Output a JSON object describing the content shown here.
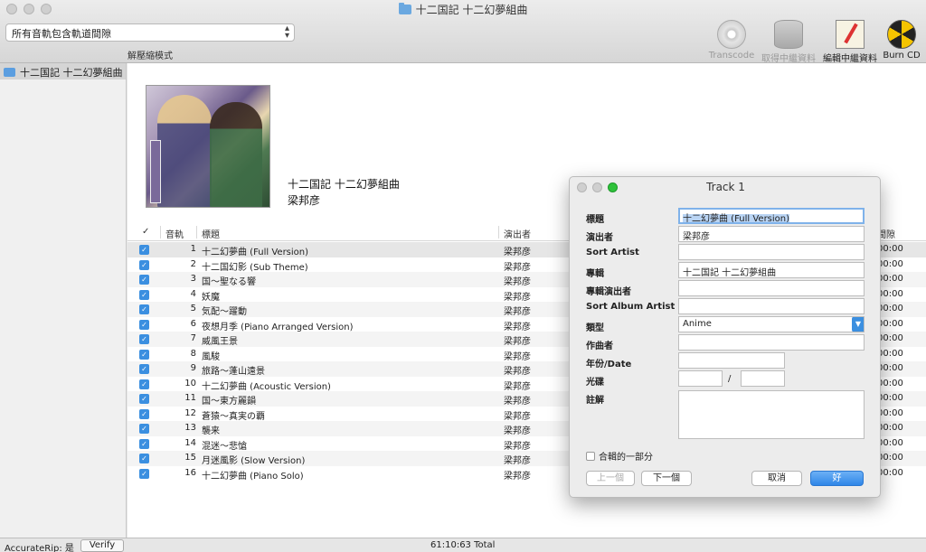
{
  "window": {
    "title": "十二国記 十二幻夢組曲"
  },
  "toolbar": {
    "gap_select": "所有音軌包含軌道間隙",
    "mode_label": "解壓縮模式",
    "buttons": [
      {
        "label": "Transcode",
        "icon": "disc-icon",
        "enabled": false
      },
      {
        "label": "取得中繼資料",
        "icon": "database-icon",
        "enabled": false
      },
      {
        "label": "編輯中繼資料",
        "icon": "notepad-icon",
        "enabled": true
      },
      {
        "label": "Burn CD",
        "icon": "burn-radiation-icon",
        "enabled": true
      }
    ]
  },
  "sidebar": {
    "items": [
      {
        "label": "十二国記 十二幻夢組曲"
      }
    ]
  },
  "album": {
    "title": "十二国記 十二幻夢組曲",
    "artist": "梁邦彦"
  },
  "table": {
    "headers": {
      "check": "✓",
      "track": "音軌",
      "title": "標題",
      "artist": "演出者",
      "time": "間隙"
    },
    "rows": [
      {
        "num": "1",
        "title": "十二幻夢曲 (Full Version)",
        "artist": "梁邦彦",
        "time": "00:00",
        "checked": true
      },
      {
        "num": "2",
        "title": "十二国幻影 (Sub Theme)",
        "artist": "梁邦彦",
        "time": "00:00",
        "checked": true
      },
      {
        "num": "3",
        "title": "国～聖なる響",
        "artist": "梁邦彦",
        "time": "00:00",
        "checked": true
      },
      {
        "num": "4",
        "title": "妖魔",
        "artist": "梁邦彦",
        "time": "00:00",
        "checked": true
      },
      {
        "num": "5",
        "title": "気配～躍動",
        "artist": "梁邦彦",
        "time": "00:00",
        "checked": true
      },
      {
        "num": "6",
        "title": "夜想月季 (Piano Arranged Version)",
        "artist": "梁邦彦",
        "time": "00:00",
        "checked": true
      },
      {
        "num": "7",
        "title": "威風王景",
        "artist": "梁邦彦",
        "time": "00:00",
        "checked": true
      },
      {
        "num": "8",
        "title": "風駿",
        "artist": "梁邦彦",
        "time": "00:00",
        "checked": true
      },
      {
        "num": "9",
        "title": "旅路～蓬山遠景",
        "artist": "梁邦彦",
        "time": "00:00",
        "checked": true
      },
      {
        "num": "10",
        "title": "十二幻夢曲 (Acoustic Version)",
        "artist": "梁邦彦",
        "time": "00:00",
        "checked": true
      },
      {
        "num": "11",
        "title": "国～東方麗韻",
        "artist": "梁邦彦",
        "time": "00:00",
        "checked": true
      },
      {
        "num": "12",
        "title": "蒼猿～真実の覇",
        "artist": "梁邦彦",
        "time": "00:00",
        "checked": true
      },
      {
        "num": "13",
        "title": "襲来",
        "artist": "梁邦彦",
        "time": "00:00",
        "checked": true
      },
      {
        "num": "14",
        "title": "混迷～悲愴",
        "artist": "梁邦彦",
        "time": "00:00",
        "checked": true
      },
      {
        "num": "15",
        "title": "月迷風影 (Slow Version)",
        "artist": "梁邦彦",
        "time": "00:00",
        "checked": true
      },
      {
        "num": "16",
        "title": "十二幻夢曲 (Piano Solo)",
        "artist": "梁邦彦",
        "time": "00:00",
        "checked": true
      }
    ]
  },
  "status": {
    "accuraterip": "AccurateRip: 是",
    "verify": "Verify",
    "total": "61:10:63 Total"
  },
  "dialog": {
    "title": "Track 1",
    "fields": {
      "title_label": "標題",
      "title_value": "十二幻夢曲 (Full Version)",
      "artist_label": "演出者",
      "artist_value": "梁邦彦",
      "sort_artist_label": "Sort Artist",
      "sort_artist_value": "",
      "album_label": "專輯",
      "album_value": "十二国記 十二幻夢組曲",
      "album_artist_label": "專輯演出者",
      "album_artist_value": "",
      "sort_album_artist_label": "Sort Album Artist",
      "sort_album_artist_value": "",
      "genre_label": "類型",
      "genre_value": "Anime",
      "composer_label": "作曲者",
      "composer_value": "",
      "year_label": "年份/Date",
      "year_value": "",
      "disc_label": "光碟",
      "disc_value": "",
      "disc_sep": "/",
      "disc_total": "",
      "notes_label": "註解"
    },
    "compilation_label": "合輯的一部分",
    "buttons": {
      "prev": "上一個",
      "next": "下一個",
      "cancel": "取消",
      "ok": "好"
    }
  }
}
